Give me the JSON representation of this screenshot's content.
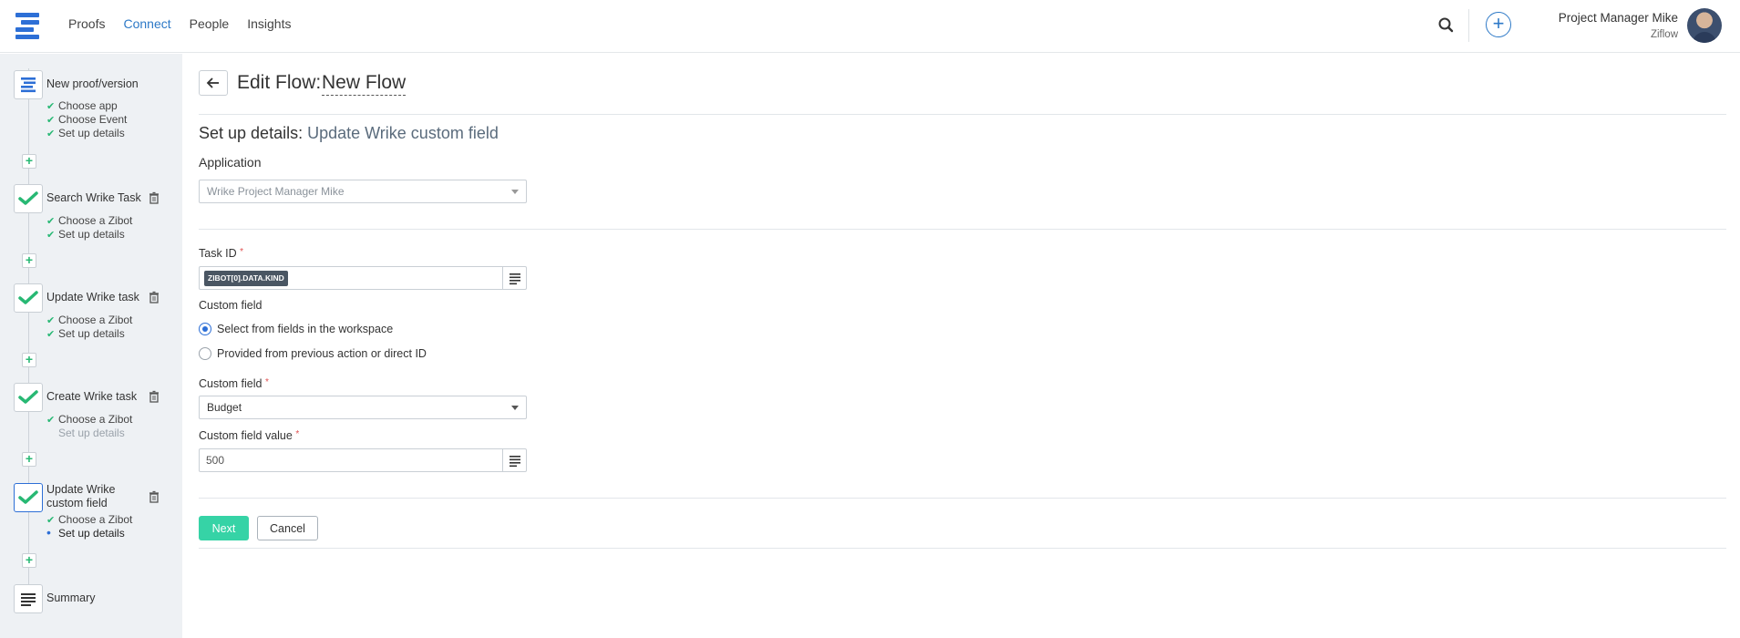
{
  "nav": {
    "items": [
      "Proofs",
      "Connect",
      "People",
      "Insights"
    ],
    "active": "Connect"
  },
  "user": {
    "name": "Project Manager Mike",
    "org": "Ziflow"
  },
  "sidebar": {
    "steps": [
      {
        "title": "New proof/version",
        "icon": "ziflow-logo-icon",
        "deletable": false,
        "subs": [
          {
            "label": "Choose app",
            "state": "done"
          },
          {
            "label": "Choose Event",
            "state": "done"
          },
          {
            "label": "Set up details",
            "state": "done"
          }
        ]
      },
      {
        "title": "Search Wrike Task",
        "icon": "wrike-check-icon",
        "deletable": true,
        "subs": [
          {
            "label": "Choose a Zibot",
            "state": "done"
          },
          {
            "label": "Set up details",
            "state": "done"
          }
        ]
      },
      {
        "title": "Update Wrike task",
        "icon": "wrike-check-icon",
        "deletable": true,
        "subs": [
          {
            "label": "Choose a Zibot",
            "state": "done"
          },
          {
            "label": "Set up details",
            "state": "done"
          }
        ]
      },
      {
        "title": "Create Wrike task",
        "icon": "wrike-check-icon",
        "deletable": true,
        "subs": [
          {
            "label": "Choose a Zibot",
            "state": "done"
          },
          {
            "label": "Set up details",
            "state": "pending"
          }
        ]
      },
      {
        "title": "Update Wrike custom field",
        "icon": "wrike-check-icon",
        "deletable": true,
        "current": true,
        "subs": [
          {
            "label": "Choose a Zibot",
            "state": "done"
          },
          {
            "label": "Set up details",
            "state": "current"
          }
        ]
      },
      {
        "title": "Summary",
        "icon": "summary-lines-icon",
        "deletable": false,
        "subs": []
      }
    ]
  },
  "header": {
    "title": "Edit Flow:",
    "flow_name": "New Flow"
  },
  "form": {
    "section_prefix": "Set up details:",
    "section_name": "Update Wrike custom field",
    "application_label": "Application",
    "application_value": "Wrike Project Manager Mike",
    "task_id_label": "Task ID",
    "task_id_token": "ZIBOT[0].DATA.KIND",
    "custom_field_source_label": "Custom field",
    "radio_options": [
      {
        "label": "Select from fields in the workspace",
        "checked": true
      },
      {
        "label": "Provided from previous action or direct ID",
        "checked": false
      }
    ],
    "custom_field_label": "Custom field",
    "custom_field_value": "Budget",
    "custom_field_value_label": "Custom field value",
    "custom_field_value_input": "500",
    "required_mark": "*"
  },
  "actions": {
    "next": "Next",
    "cancel": "Cancel"
  },
  "colors": {
    "accent": "#2d6fd6",
    "success": "#27b873",
    "next_button": "#36d3a6"
  }
}
